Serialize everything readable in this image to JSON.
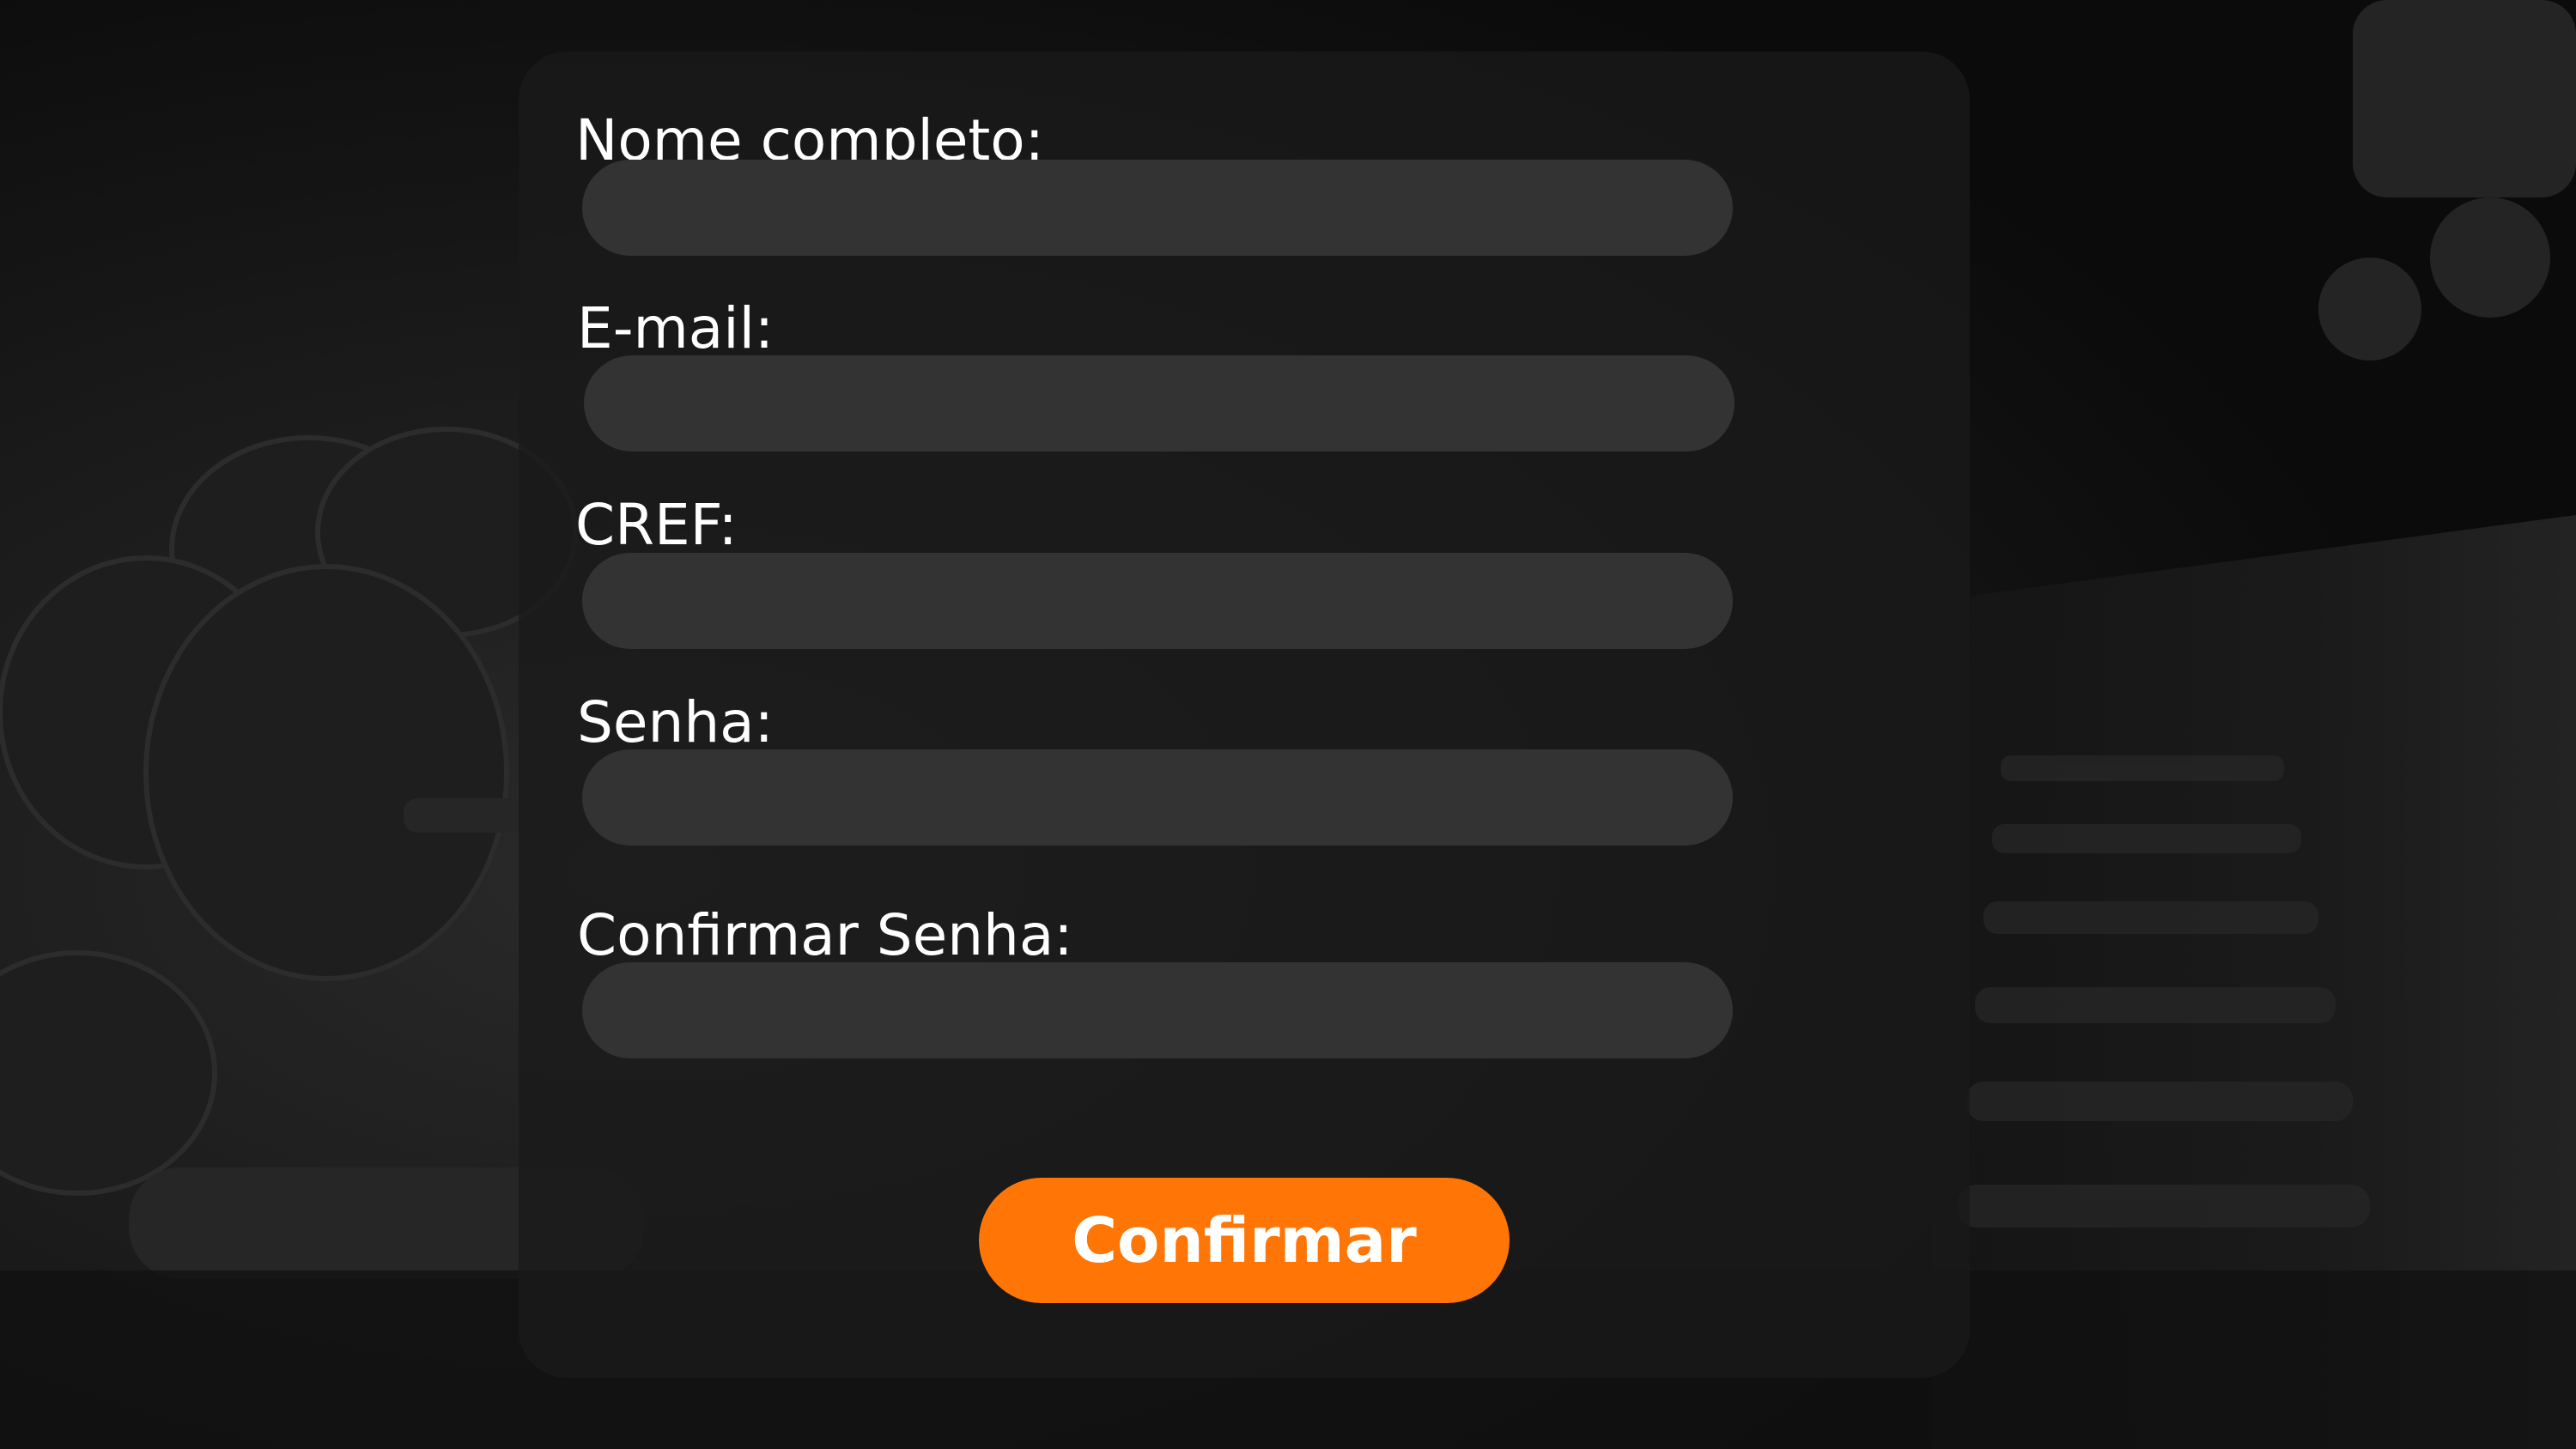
{
  "form": {
    "fields": [
      {
        "label": "Nome completo:",
        "value": "",
        "type": "text"
      },
      {
        "label": "E-mail:",
        "value": "",
        "type": "email"
      },
      {
        "label": "CREF:",
        "value": "",
        "type": "text"
      },
      {
        "label": "Senha:",
        "value": "",
        "type": "password"
      },
      {
        "label": "Confirmar Senha:",
        "value": "",
        "type": "password"
      }
    ],
    "submit_label": "Confirmar"
  },
  "colors": {
    "background": "#0e0e0e",
    "panel": "#1a1a1a",
    "input": "#333333",
    "accent": "#ff7607",
    "text": "#ffffff"
  },
  "background_image": {
    "description_icon": "gym-dumbbell-rack-photo"
  }
}
